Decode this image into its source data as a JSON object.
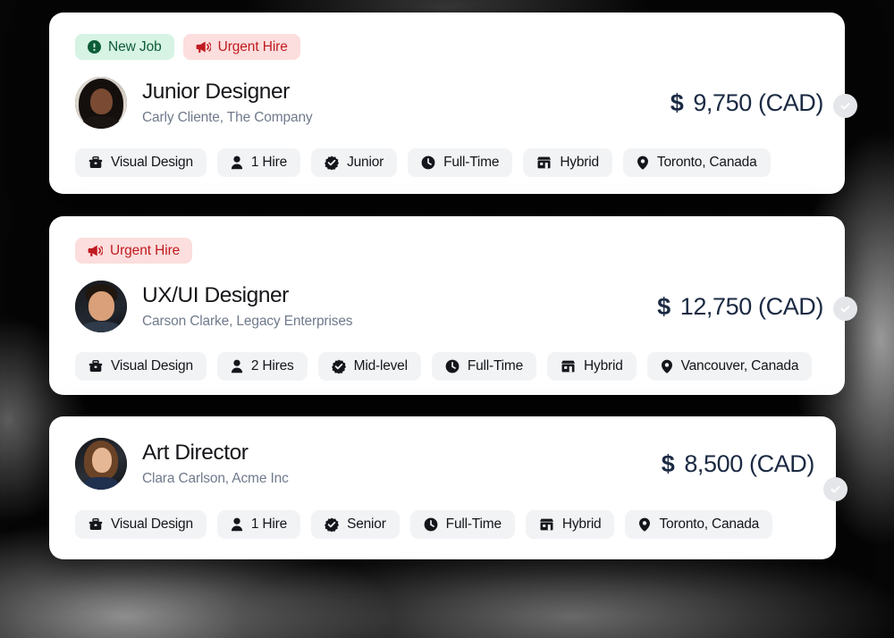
{
  "theme": {
    "card_bg": "#ffffff",
    "page_bg": "#000000",
    "badge_new_bg": "#d6f3e3",
    "badge_new_fg": "#0d5c38",
    "badge_urgent_bg": "#fbdedd",
    "badge_urgent_fg": "#c01b20",
    "tag_bg": "#f2f3f5",
    "tag_fg": "#14161b",
    "salary_fg": "#1b2a43",
    "subtitle_fg": "#707a8c",
    "check_circle_bg": "#e4e6e9"
  },
  "cards": [
    {
      "badges": [
        {
          "label": "New Job",
          "icon": "exclamation-circle-icon",
          "style": "green"
        },
        {
          "label": "Urgent Hire",
          "icon": "megaphone-icon",
          "style": "red"
        }
      ],
      "avatar": {
        "icon": "avatar-image",
        "alt": "Carly Cliente"
      },
      "title": "Junior Designer",
      "subtitle": "Carly Cliente, The Company",
      "salary": {
        "currency_symbol": "$",
        "amount": "9,750",
        "currency_code": "(CAD)"
      },
      "status_icon": "check-circle-icon",
      "tags": [
        {
          "label": "Visual Design",
          "icon": "briefcase-icon"
        },
        {
          "label": "1 Hire",
          "icon": "person-icon"
        },
        {
          "label": "Junior",
          "icon": "verified-badge-icon"
        },
        {
          "label": "Full-Time",
          "icon": "clock-icon"
        },
        {
          "label": "Hybrid",
          "icon": "building-icon"
        },
        {
          "label": "Toronto, Canada",
          "icon": "map-pin-icon"
        }
      ]
    },
    {
      "badges": [
        {
          "label": "Urgent Hire",
          "icon": "megaphone-icon",
          "style": "red"
        }
      ],
      "avatar": {
        "icon": "avatar-image",
        "alt": "Carson Clarke"
      },
      "title": "UX/UI Designer",
      "subtitle": "Carson Clarke, Legacy Enterprises",
      "salary": {
        "currency_symbol": "$",
        "amount": "12,750",
        "currency_code": "(CAD)"
      },
      "status_icon": "check-circle-icon",
      "tags": [
        {
          "label": "Visual Design",
          "icon": "briefcase-icon"
        },
        {
          "label": "2 Hires",
          "icon": "person-icon"
        },
        {
          "label": "Mid-level",
          "icon": "verified-badge-icon"
        },
        {
          "label": "Full-Time",
          "icon": "clock-icon"
        },
        {
          "label": "Hybrid",
          "icon": "building-icon"
        },
        {
          "label": "Vancouver, Canada",
          "icon": "map-pin-icon"
        }
      ]
    },
    {
      "badges": [],
      "avatar": {
        "icon": "avatar-image",
        "alt": "Clara Carlson"
      },
      "title": "Art Director",
      "subtitle": "Clara Carlson, Acme Inc",
      "salary": {
        "currency_symbol": "$",
        "amount": "8,500",
        "currency_code": "(CAD)"
      },
      "status_icon": "check-circle-icon",
      "tags": [
        {
          "label": "Visual Design",
          "icon": "briefcase-icon"
        },
        {
          "label": "1 Hire",
          "icon": "person-icon"
        },
        {
          "label": "Senior",
          "icon": "verified-badge-icon"
        },
        {
          "label": "Full-Time",
          "icon": "clock-icon"
        },
        {
          "label": "Hybrid",
          "icon": "building-icon"
        },
        {
          "label": "Toronto, Canada",
          "icon": "map-pin-icon"
        }
      ]
    }
  ]
}
